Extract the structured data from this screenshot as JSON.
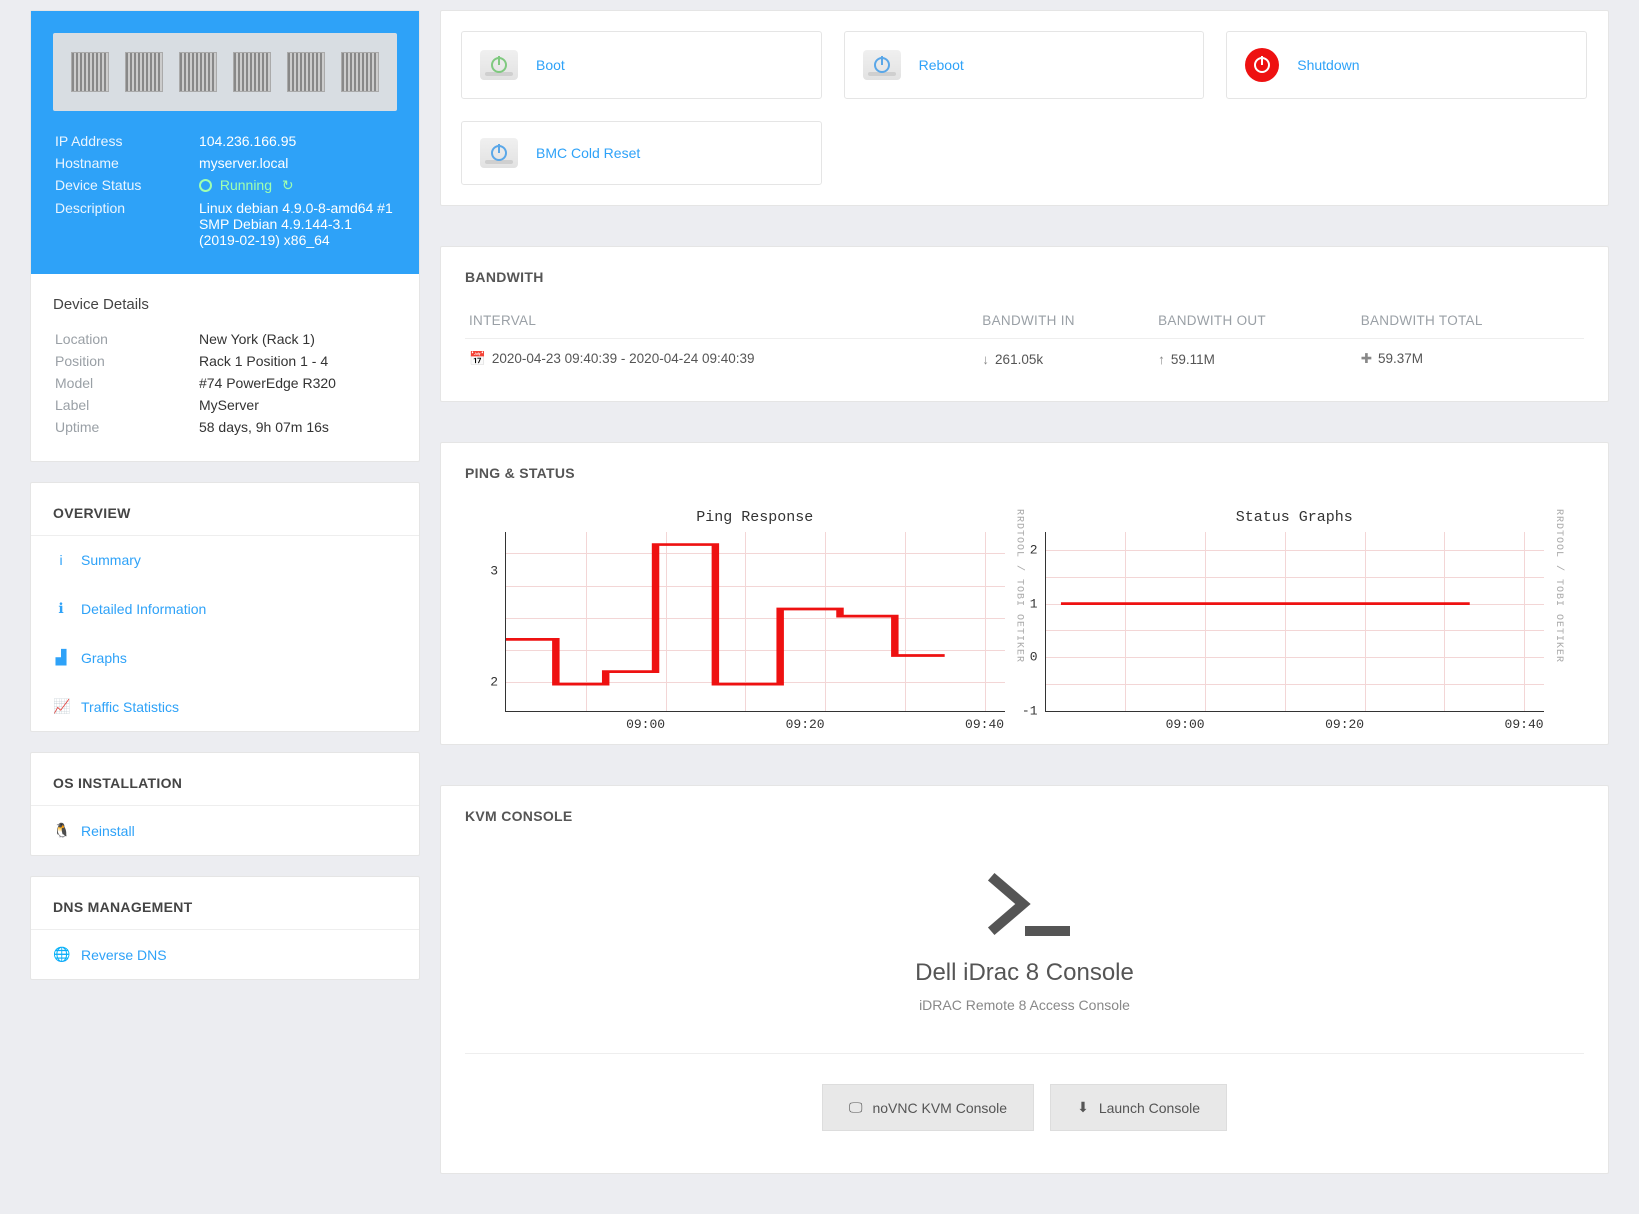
{
  "info": {
    "ip_label": "IP Address",
    "ip": "104.236.166.95",
    "host_label": "Hostname",
    "host": "myserver.local",
    "status_label": "Device Status",
    "status": "Running",
    "desc_label": "Description",
    "desc": "Linux debian 4.9.0-8-amd64 #1 SMP Debian 4.9.144-3.1 (2019-02-19) x86_64"
  },
  "details": {
    "heading": "Device Details",
    "location_label": "Location",
    "location": "New York (Rack 1)",
    "position_label": "Position",
    "position": "Rack 1 Position 1 - 4",
    "model_label": "Model",
    "model": "#74 PowerEdge R320",
    "label_label": "Label",
    "label": "MyServer",
    "uptime_label": "Uptime",
    "uptime": "58 days, 9h 07m 16s"
  },
  "nav": {
    "overview": {
      "heading": "OVERVIEW",
      "summary": "Summary",
      "detailed": "Detailed Information",
      "graphs": "Graphs",
      "traffic": "Traffic Statistics"
    },
    "os": {
      "heading": "OS INSTALLATION",
      "reinstall": "Reinstall"
    },
    "dns": {
      "heading": "DNS MANAGEMENT",
      "reverse": "Reverse DNS"
    }
  },
  "actions": {
    "boot": "Boot",
    "reboot": "Reboot",
    "shutdown": "Shutdown",
    "bmc": "BMC Cold Reset"
  },
  "bandwidth": {
    "heading": "BANDWITH",
    "cols": {
      "interval": "INTERVAL",
      "in": "BANDWITH IN",
      "out": "BANDWITH OUT",
      "total": "BANDWITH TOTAL"
    },
    "interval_text": "2020-04-23 09:40:39 - 2020-04-24 09:40:39",
    "in": "261.05k",
    "out": "59.11M",
    "total": "59.37M"
  },
  "ping_status": {
    "heading": "PING & STATUS",
    "ping_title": "Ping Response",
    "status_title": "Status Graphs",
    "side_label": "RRDTOOL / TOBI OETIKER",
    "xticks": [
      "09:00",
      "09:20",
      "09:40"
    ],
    "ping_yticks": [
      "2",
      "3"
    ],
    "status_yticks": [
      "-1",
      "0",
      "1",
      "2"
    ]
  },
  "kvm": {
    "heading": "KVM CONSOLE",
    "title": "Dell iDrac 8 Console",
    "sub": "iDRAC Remote 8 Access Console",
    "novnc": "noVNC KVM Console",
    "launch": "Launch Console"
  },
  "chart_data": [
    {
      "type": "line",
      "title": "Ping Response",
      "xlabel": "",
      "ylabel": "",
      "ylim": [
        2,
        3.6
      ],
      "x": [
        "08:48",
        "08:52",
        "08:56",
        "09:00",
        "09:04",
        "09:08",
        "09:12",
        "09:16",
        "09:20",
        "09:24",
        "09:28",
        "09:32"
      ],
      "series": [
        {
          "name": "ping_ms",
          "values": [
            2.4,
            2.4,
            2.0,
            2.1,
            2.1,
            3.5,
            3.5,
            2.0,
            2.0,
            2.7,
            2.7,
            2.3
          ]
        }
      ],
      "xticks": [
        "09:00",
        "09:20",
        "09:40"
      ]
    },
    {
      "type": "line",
      "title": "Status Graphs",
      "xlabel": "",
      "ylabel": "",
      "ylim": [
        -1,
        2
      ],
      "x": [
        "08:48",
        "09:00",
        "09:10",
        "09:20",
        "09:30",
        "09:40"
      ],
      "series": [
        {
          "name": "status",
          "values": [
            1,
            1,
            1,
            1,
            1,
            1
          ]
        }
      ],
      "xticks": [
        "09:00",
        "09:20",
        "09:40"
      ]
    }
  ]
}
